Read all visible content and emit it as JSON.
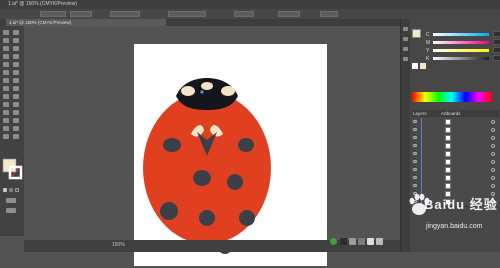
{
  "window": {
    "title": "1.ai* @ 150% (CMYK/Preview)"
  },
  "document": {
    "tab_label": "1.ai* @ 150% (CMYK/Preview)"
  },
  "control_bar": {
    "zoom_readout": "100%"
  },
  "status_bar": {
    "zoom": "150%"
  },
  "color_panel": {
    "channels": [
      {
        "label": "C",
        "color": "#00aeef"
      },
      {
        "label": "M",
        "color": "#ec008c"
      },
      {
        "label": "Y",
        "color": "#fff200"
      },
      {
        "label": "K",
        "color": "#231f20"
      }
    ]
  },
  "layers_panel": {
    "tab_labels": [
      "Layers",
      "Artboards"
    ],
    "row_count": 11
  },
  "artwork": {
    "shell_color": "#e0401f",
    "spot_color": "#3a3f48",
    "head_color": "#14161c",
    "cream_color": "#f4e4c8"
  },
  "watermark": {
    "brand": "Baidu 经验",
    "url": "jingyan.baidu.com"
  },
  "swatches": {
    "fill": "#f6e7c9",
    "stroke": "#ffffff"
  }
}
